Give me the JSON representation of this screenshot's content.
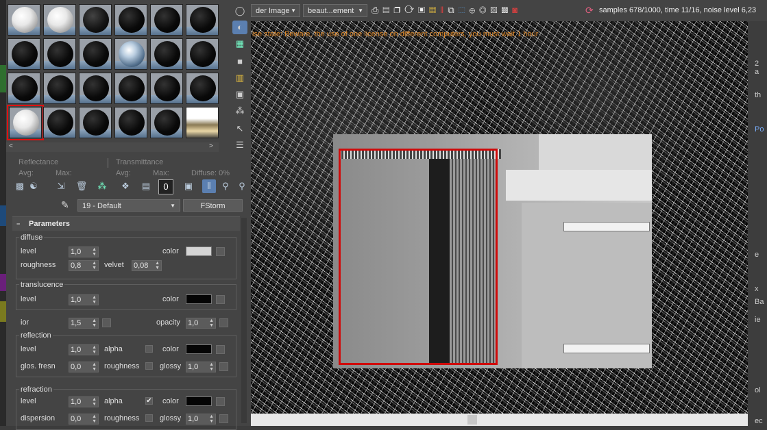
{
  "framebuffer": {
    "render_dropdown": "der Image",
    "element_dropdown": "beaut...ement",
    "status": "samples 678/1000, time 11/16, noise level 6,23",
    "license_warning": "ise state: Beware, the use of one license on different computers, you must wait 1 hour",
    "right_panel_fragments": [
      "2",
      "a",
      "th",
      "Po",
      "e",
      "x",
      "Ba",
      "ie",
      "ol",
      "ec"
    ]
  },
  "material_editor": {
    "reflectance_label": "Reflectance",
    "transmittance_label": "Transmittance",
    "avg_label": "Avg:",
    "max_label": "Max:",
    "avg_label_2": "Avg:",
    "max_label_2": "Max:",
    "diffuse_pct": "Diffuse:  0%",
    "material_name": "19 - Default",
    "material_type": "FStorm",
    "rollout_title": "Parameters"
  },
  "params": {
    "diffuse": {
      "title": "diffuse",
      "level_label": "level",
      "level": "1,0",
      "color_label": "color",
      "color": "#d4d4d4",
      "roughness_label": "roughness",
      "roughness": "0,8",
      "velvet_label": "velvet",
      "velvet": "0,08"
    },
    "translucence": {
      "title": "translucence",
      "level_label": "level",
      "level": "1,0",
      "color_label": "color",
      "color": "#050505"
    },
    "ior": {
      "label": "ior",
      "value": "1,5",
      "opacity_label": "opacity",
      "opacity": "1,0"
    },
    "reflection": {
      "title": "reflection",
      "level_label": "level",
      "level": "1,0",
      "alpha_label": "alpha",
      "color_label": "color",
      "color": "#050505",
      "glos_label": "glos. fresn",
      "glos": "0,0",
      "roughness_label": "roughness",
      "glossy_label": "glossy",
      "glossy": "1,0"
    },
    "refraction": {
      "title": "refraction",
      "level_label": "level",
      "level": "1,0",
      "alpha_label": "alpha",
      "alpha_checked": "✔",
      "color_label": "color",
      "color": "#050505",
      "dispersion_label": "dispersion",
      "dispersion": "0,0",
      "roughness_label": "roughness",
      "glossy_label": "glossy",
      "glossy": "1,0"
    }
  },
  "icons": [
    "sphere-icon",
    "backlight-icon",
    "checker-icon",
    "sample-uv-icon",
    "video-color-icon",
    "make-preview-icon",
    "options-icon",
    "select-by-material-icon",
    "material-map-navigator-icon",
    "get-material-icon",
    "put-to-scene-icon",
    "assign-icon",
    "reset-icon",
    "make-unique-icon",
    "put-to-library-icon",
    "material-id-icon",
    "show-map-icon",
    "show-end-result-icon",
    "go-parent-icon",
    "go-sibling-icon",
    "eyedropper-icon"
  ]
}
